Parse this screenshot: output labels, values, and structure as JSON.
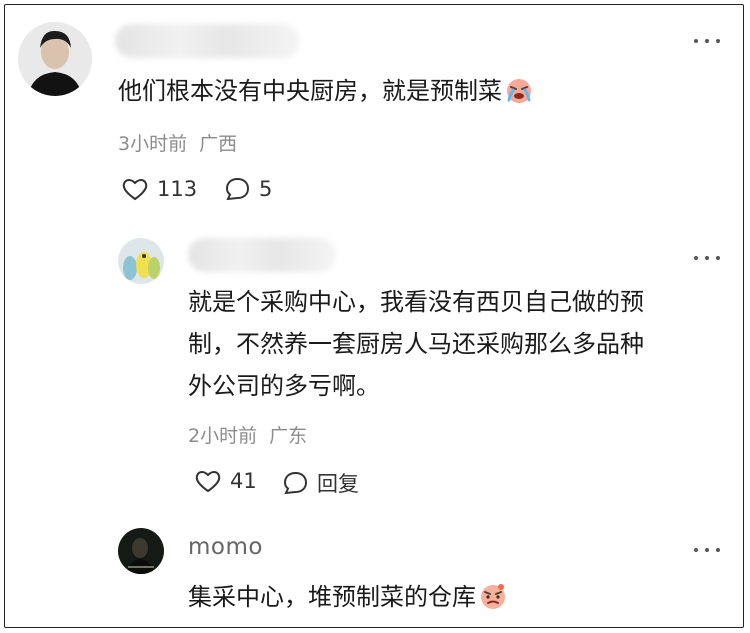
{
  "comments": [
    {
      "text": "他们根本没有中央厨房，就是预制菜",
      "emoji": "crying-face-emoji",
      "time": "3小时前",
      "location": "广西",
      "likes": "113",
      "replies": "5"
    },
    {
      "text_lines": [
        "就是个采购中心，我看没有西贝自己做的预",
        "制，不然养一套厨房人马还采购那么多品种",
        "外公司的多亏啊。"
      ],
      "time": "2小时前",
      "location": "广东",
      "likes": "41",
      "reply_label": "回复"
    },
    {
      "username": "momo",
      "text": "集采中心，堆预制菜的仓库",
      "emoji": "annoyed-face-emoji"
    }
  ],
  "colors": {
    "text": "#1a1a1a",
    "meta": "#8c8c8c",
    "border": "#222222"
  }
}
